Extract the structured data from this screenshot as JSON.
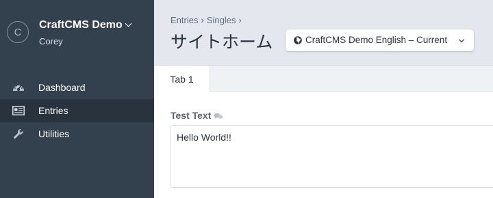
{
  "sidebar": {
    "site_logo_letter": "C",
    "site_name": "CraftCMS Demo",
    "user_name": "Corey",
    "items": [
      {
        "label": "Dashboard",
        "icon": "dashboard-gauge-icon",
        "selected": false
      },
      {
        "label": "Entries",
        "icon": "entries-newspaper-icon",
        "selected": true
      },
      {
        "label": "Utilities",
        "icon": "wrench-icon",
        "selected": false
      }
    ]
  },
  "header": {
    "breadcrumbs": [
      "Entries",
      "Singles"
    ],
    "breadcrumb_separator": "›",
    "title": "サイトホーム",
    "site_menu_label": "CraftCMS Demo English – Current",
    "site_menu_icon": "globe-icon"
  },
  "tabs": [
    {
      "label": "Tab 1",
      "selected": true
    }
  ],
  "fields": [
    {
      "label": "Test Text",
      "translatable_icon": "translate-speech-bubbles-icon",
      "value": "Hello World!!"
    }
  ],
  "colors": {
    "sidebar_bg": "#33404d",
    "sidebar_selected_bg": "#29333e",
    "header_bg": "#e4e8ee",
    "content_bg": "#ffffff",
    "text_dark": "#29323d",
    "label_color": "#546373"
  }
}
